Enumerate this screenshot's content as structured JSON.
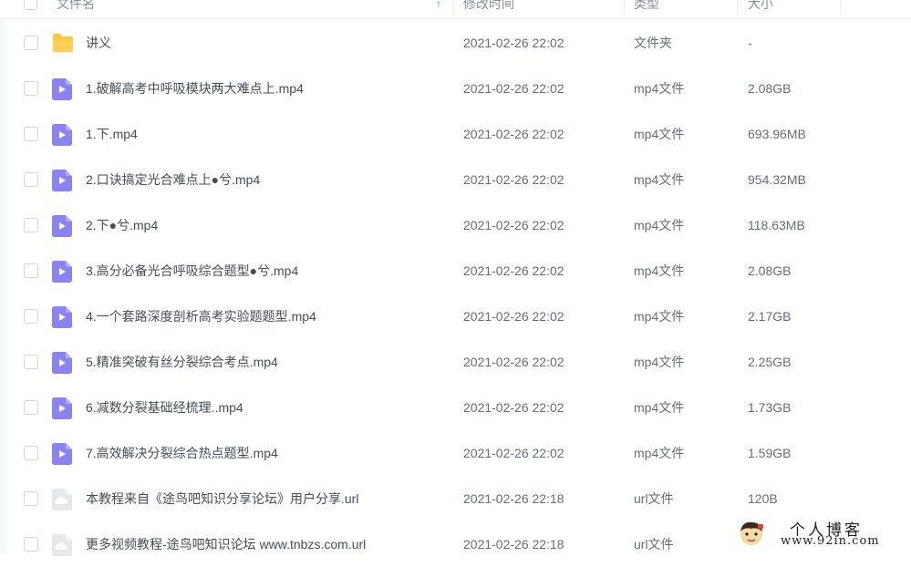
{
  "header": {
    "name_label": "文件名",
    "time_label": "修改时间",
    "type_label": "类型",
    "size_label": "大小",
    "sort_arrow": "↑"
  },
  "icons": {
    "folder": "folder-icon",
    "video": "video-file-icon",
    "url": "url-file-icon"
  },
  "colors": {
    "folder": "#ffc53d",
    "video": "#8b82f5",
    "url_file": "#e6e8ec",
    "accent": "#3b8cff"
  },
  "files": [
    {
      "name": "讲义",
      "time": "2021-02-26 22:02",
      "type": "文件夹",
      "size": "-",
      "kind": "folder"
    },
    {
      "name": "1.破解高考中呼吸模块两大难点上.mp4",
      "time": "2021-02-26 22:02",
      "type": "mp4文件",
      "size": "2.08GB",
      "kind": "video"
    },
    {
      "name": "1.下.mp4",
      "time": "2021-02-26 22:02",
      "type": "mp4文件",
      "size": "693.96MB",
      "kind": "video"
    },
    {
      "name": "2.口诀搞定光合难点上●兮.mp4",
      "time": "2021-02-26 22:02",
      "type": "mp4文件",
      "size": "954.32MB",
      "kind": "video"
    },
    {
      "name": "2.下●兮.mp4",
      "time": "2021-02-26 22:02",
      "type": "mp4文件",
      "size": "118.63MB",
      "kind": "video"
    },
    {
      "name": "3.高分必备光合呼吸综合题型●兮.mp4",
      "time": "2021-02-26 22:02",
      "type": "mp4文件",
      "size": "2.08GB",
      "kind": "video"
    },
    {
      "name": "4.一个套路深度剖析高考实验题题型.mp4",
      "time": "2021-02-26 22:02",
      "type": "mp4文件",
      "size": "2.17GB",
      "kind": "video"
    },
    {
      "name": "5.精准突破有丝分裂综合考点.mp4",
      "time": "2021-02-26 22:02",
      "type": "mp4文件",
      "size": "2.25GB",
      "kind": "video"
    },
    {
      "name": "6.减数分裂基础经梳理..mp4",
      "time": "2021-02-26 22:02",
      "type": "mp4文件",
      "size": "1.73GB",
      "kind": "video"
    },
    {
      "name": "7.高效解决分裂综合热点题型.mp4",
      "time": "2021-02-26 22:02",
      "type": "mp4文件",
      "size": "1.59GB",
      "kind": "video"
    },
    {
      "name": "本教程来自《途鸟吧知识分享论坛》用户分享.url",
      "time": "2021-02-26 22:18",
      "type": "url文件",
      "size": "120B",
      "kind": "url"
    },
    {
      "name": "更多视频教程-途鸟吧知识论坛 www.tnbzs.com.url",
      "time": "2021-02-26 22:18",
      "type": "url文件",
      "size": "",
      "kind": "url"
    }
  ],
  "watermark": {
    "title": "个人博客",
    "url": "www.92in.com"
  }
}
